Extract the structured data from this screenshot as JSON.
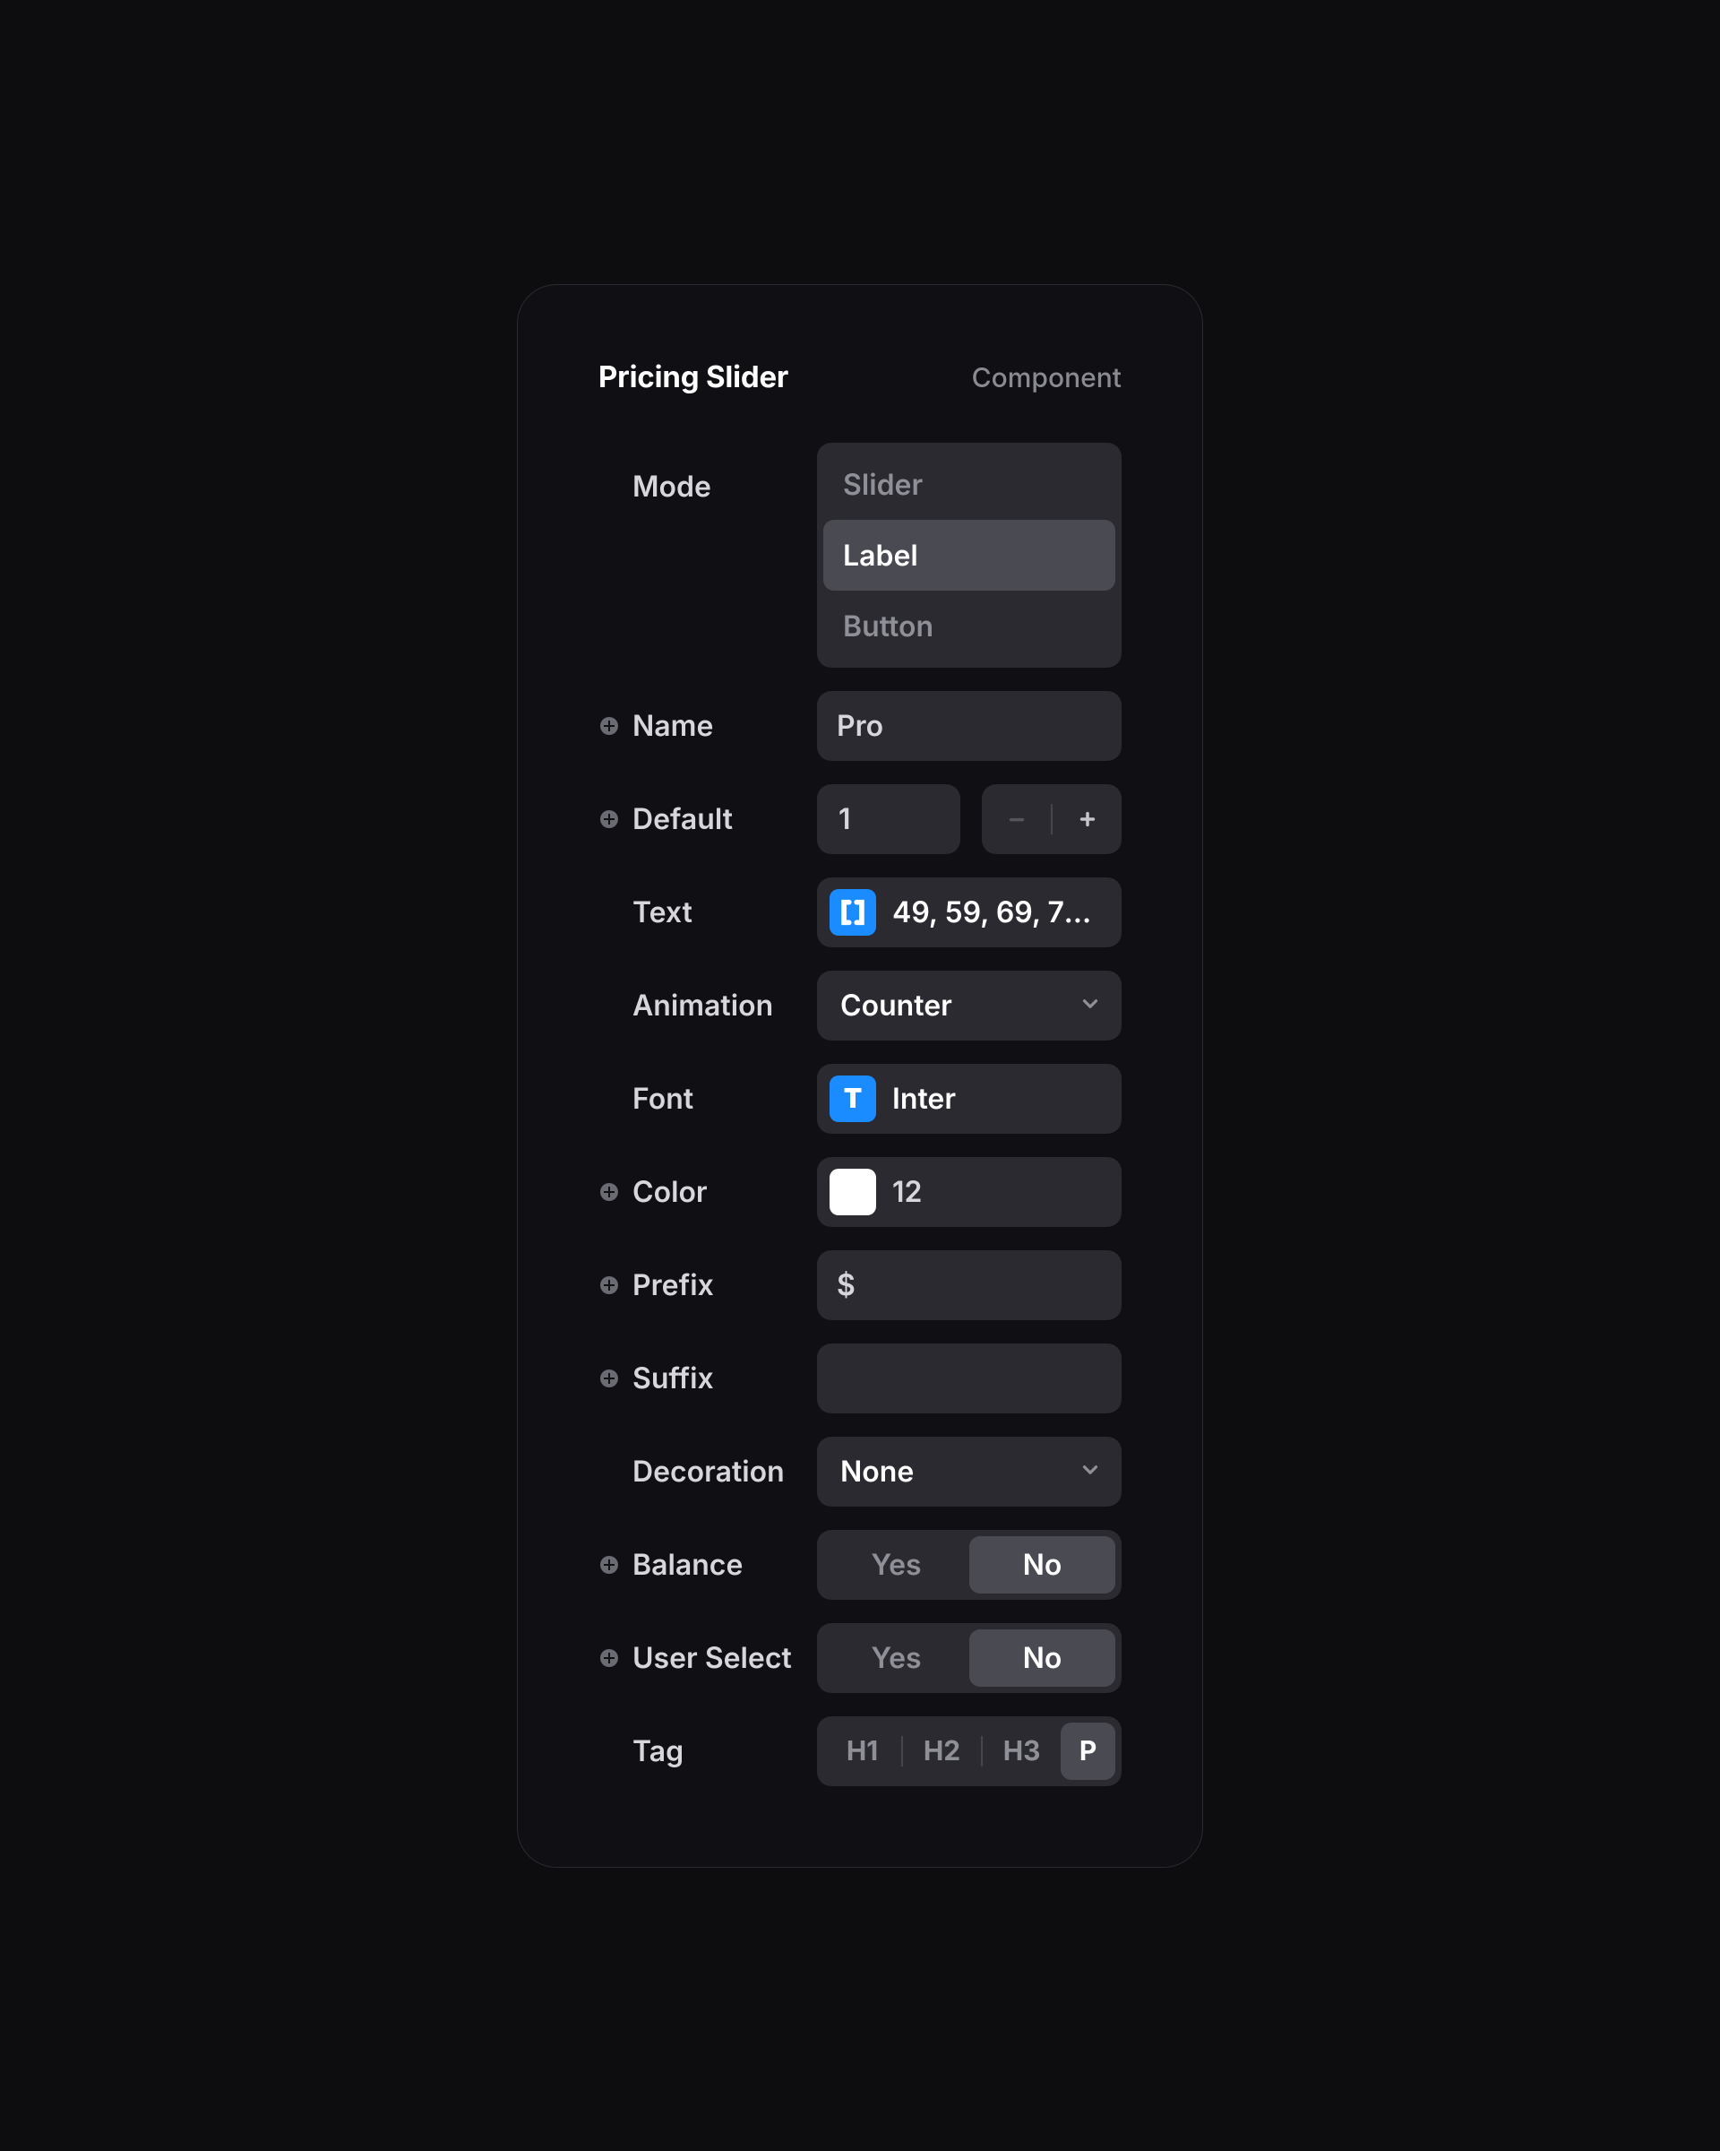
{
  "header": {
    "title": "Pricing Slider",
    "badge": "Component"
  },
  "mode": {
    "label": "Mode",
    "options": {
      "slider": "Slider",
      "label_opt": "Label",
      "button": "Button"
    },
    "selected": "Label"
  },
  "name": {
    "label": "Name",
    "value": "Pro"
  },
  "default_field": {
    "label": "Default",
    "value": "1"
  },
  "text_field": {
    "label": "Text",
    "value": "49, 59, 69, 79, ..."
  },
  "animation": {
    "label": "Animation",
    "value": "Counter"
  },
  "font": {
    "label": "Font",
    "value": "Inter",
    "chip": "T"
  },
  "color": {
    "label": "Color",
    "value": "12",
    "swatch": "#ffffff"
  },
  "prefix": {
    "label": "Prefix",
    "value": "$"
  },
  "suffix": {
    "label": "Suffix",
    "value": ""
  },
  "decoration": {
    "label": "Decoration",
    "value": "None"
  },
  "balance": {
    "label": "Balance",
    "yes": "Yes",
    "no": "No",
    "selected": "No"
  },
  "user_select": {
    "label": "User Select",
    "yes": "Yes",
    "no": "No",
    "selected": "No"
  },
  "tag": {
    "label": "Tag",
    "h1": "H1",
    "h2": "H2",
    "h3": "H3",
    "p": "P",
    "selected": "P"
  }
}
